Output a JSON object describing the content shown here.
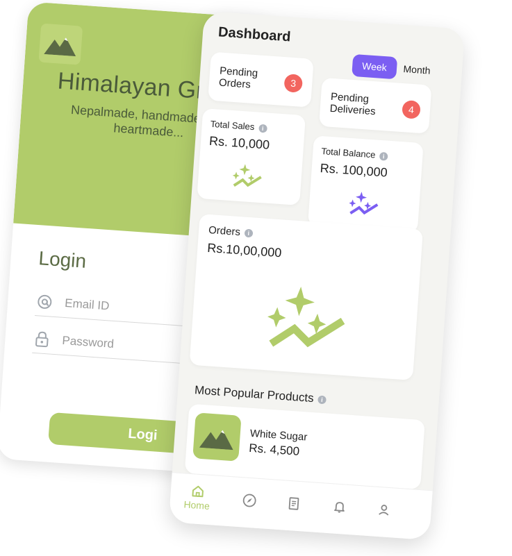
{
  "colors": {
    "brand_green": "#b1cc6a",
    "dark_green": "#4a5a3a",
    "accent_purple": "#7b5ef2",
    "badge_red": "#f2655f"
  },
  "login": {
    "brand_title": "Himalayan Green",
    "tagline": "Nepalmade, handmade, and heartmade...",
    "heading": "Login",
    "email_placeholder": "Email ID",
    "password_placeholder": "Password",
    "login_button": "Login",
    "login_button_visible": "Logi"
  },
  "dashboard": {
    "title": "Dashboard",
    "period_options": [
      "Week",
      "Month"
    ],
    "selected_period": "Week",
    "pending_orders": {
      "label_line1": "Pending",
      "label_line2": "Orders",
      "count": "3"
    },
    "pending_deliveries": {
      "label_line1": "Pending",
      "label_line2": "Deliveries",
      "count": "4"
    },
    "total_sales": {
      "label": "Total Sales",
      "value": "Rs. 10,000"
    },
    "total_balance": {
      "label": "Total Balance",
      "value": "Rs. 100,000"
    },
    "orders": {
      "label": "Orders",
      "value": "Rs.10,00,000"
    },
    "popular": {
      "title": "Most Popular Products",
      "product_name": "White Sugar",
      "product_price": "Rs. 4,500"
    },
    "nav": {
      "home_label": "Home",
      "items": [
        "home-icon",
        "compass-icon",
        "receipt-icon",
        "bell-icon",
        "user-icon"
      ]
    }
  }
}
